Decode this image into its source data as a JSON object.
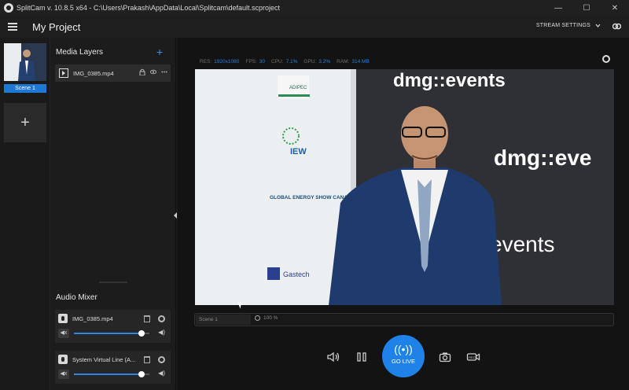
{
  "window": {
    "title": "SplitCam v. 10.8.5 x64 - C:\\Users\\Prakash\\AppData\\Local\\Splitcam\\default.scproject",
    "minimize": "—",
    "maximize": "☐",
    "close": "✕"
  },
  "header": {
    "project_title": "My Project",
    "stream_settings_label": "STREAM SETTINGS"
  },
  "scenes": {
    "items": [
      {
        "label": "Scene 1"
      }
    ],
    "add_label": "+"
  },
  "media_layers": {
    "title": "Media Layers",
    "add_label": "+",
    "items": [
      {
        "name": "IMG_0385.mp4"
      }
    ]
  },
  "audio_mixer": {
    "title": "Audio Mixer",
    "items": [
      {
        "name": "IMG_0385.mp4",
        "volume": 0.9,
        "accent": "#2f86e8"
      },
      {
        "name": "System Virtual Line (A...",
        "volume": 0.9,
        "accent": "#2f86e8"
      }
    ]
  },
  "stats": {
    "res_label": "RES:",
    "res_value": "1920x1080",
    "fps_label": "FPS:",
    "fps_value": "30",
    "cpu_label": "CPU:",
    "cpu_value": "7.1%",
    "gpu_label": "GPU:",
    "gpu_value": "3.2%",
    "ram_label": "RAM:",
    "ram_value": "314 MB"
  },
  "preview": {
    "scene_name": "Scene 1",
    "zoom": "100 %",
    "backdrop": {
      "left_logos": [
        "ADIPEC",
        "IEW",
        "GLOBAL ENERGY SHOW CANADA",
        "Gastech"
      ],
      "right_text_top": "dmg::events",
      "right_text_mid": "dmg::eve",
      "right_text_low": "events"
    }
  },
  "controls": {
    "go_live_label": "GO LIVE",
    "go_live_color": "#1e82e8"
  }
}
